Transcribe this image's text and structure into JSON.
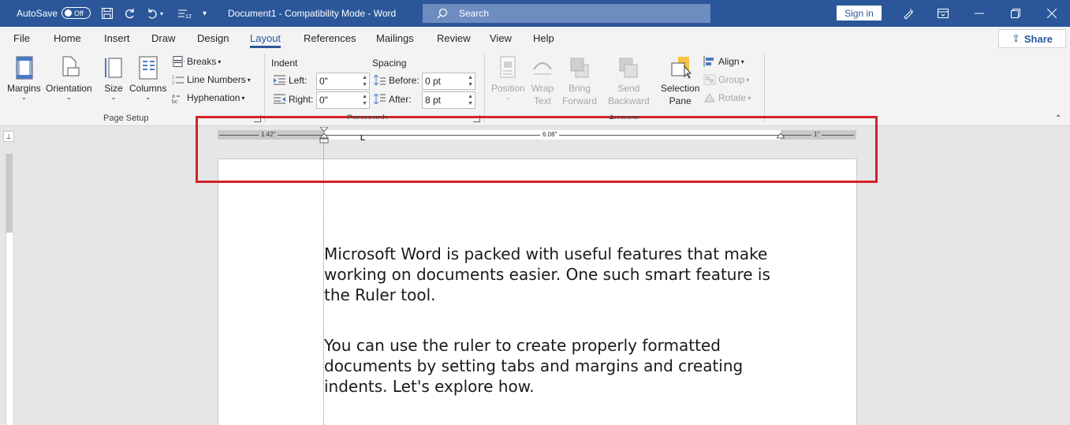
{
  "titlebar": {
    "autosave_label": "AutoSave",
    "autosave_state": "Off",
    "doc_title": "Document1  -  Compatibility Mode  -  Word",
    "search_placeholder": "Search",
    "sign_in": "Sign in"
  },
  "menu": {
    "tabs": [
      "File",
      "Home",
      "Insert",
      "Draw",
      "Design",
      "Layout",
      "References",
      "Mailings",
      "Review",
      "View",
      "Help"
    ],
    "active": "Layout",
    "share": "Share"
  },
  "ribbon": {
    "page_setup": {
      "margins": "Margins",
      "orientation": "Orientation",
      "size": "Size",
      "columns": "Columns",
      "breaks": "Breaks",
      "line_numbers": "Line Numbers",
      "hyphenation": "Hyphenation",
      "group_label": "Page Setup"
    },
    "paragraph": {
      "indent_label": "Indent",
      "spacing_label": "Spacing",
      "left_label": "Left:",
      "left_value": "0\"",
      "right_label": "Right:",
      "right_value": "0\"",
      "before_label": "Before:",
      "before_value": "0 pt",
      "after_label": "After:",
      "after_value": "8 pt",
      "group_label": "Paragraph"
    },
    "arrange": {
      "position": "Position",
      "wrap_text_1": "Wrap",
      "wrap_text_2": "Text",
      "bring_forward_1": "Bring",
      "bring_forward_2": "Forward",
      "send_backward_1": "Send",
      "send_backward_2": "Backward",
      "selection_pane_1": "Selection",
      "selection_pane_2": "Pane",
      "align": "Align",
      "group": "Group",
      "rotate": "Rotate",
      "group_label": "Arrange"
    }
  },
  "ruler": {
    "left_margin": "1.42\"",
    "text_width": "6.08\"",
    "right_margin": "1\""
  },
  "document": {
    "para1": "Microsoft Word is packed with useful features that make working on documents easier. One such smart feature is the Ruler tool.",
    "para2": "You can use the ruler to create properly formatted documents by setting tabs and margins and creating indents. Let's explore how."
  },
  "colors": {
    "accent": "#2b579a",
    "highlight": "#d3222a"
  }
}
